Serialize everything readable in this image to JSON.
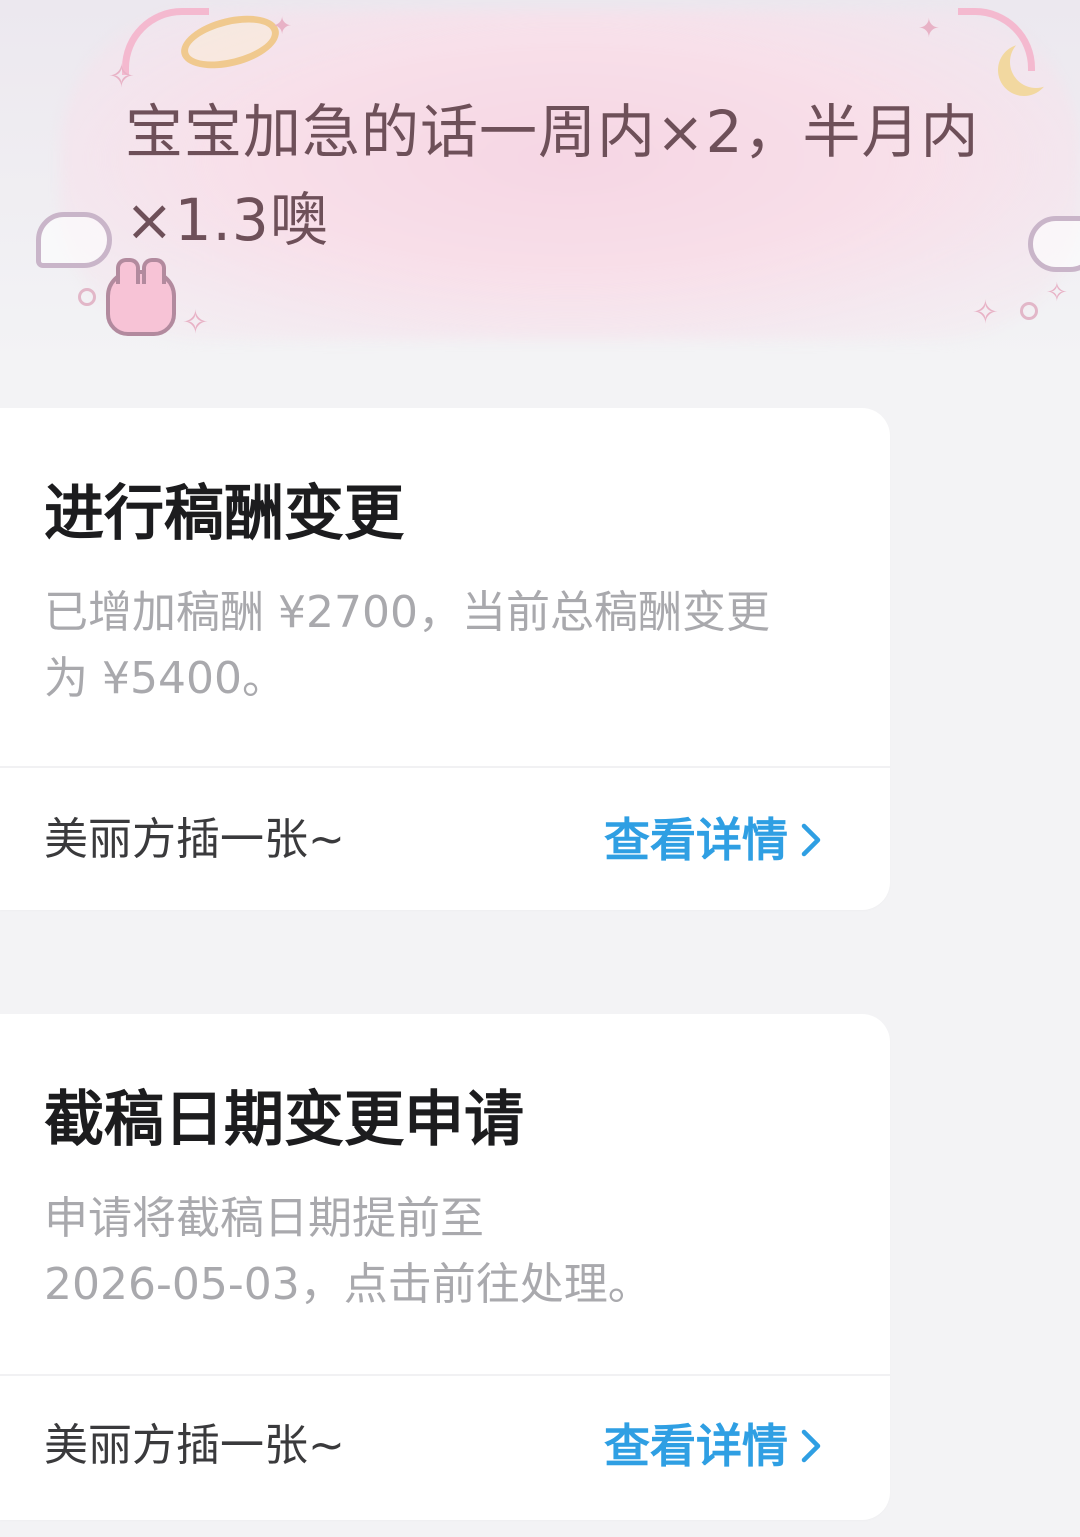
{
  "header_bubble": {
    "line1": "宝宝加急的话一周内×2，半月内",
    "line2": "×1.3噢"
  },
  "cards": [
    {
      "title": "进行稿酬变更",
      "description_line1": "已增加稿酬 ¥2700，当前总稿酬变更",
      "description_line2": "为 ¥5400。",
      "footer_label": "美丽方插一张~",
      "link_label": "查看详情"
    },
    {
      "title": "截稿日期变更申请",
      "description_line1": "申请将截稿日期提前至",
      "description_line2": "2026-05-03，点击前往处理。",
      "footer_label": "美丽方插一张~",
      "link_label": "查看详情"
    }
  ],
  "colors": {
    "link": "#2f9fe3",
    "title": "#1c1c1e",
    "description": "#a9a9ad",
    "bubble_text": "#6e5059"
  },
  "icons": {
    "link_chevron": "chevron-right-icon",
    "decorations": [
      "halo-icon",
      "angel-wing-icon",
      "moon-icon",
      "bunny-icon",
      "sparkle-icon"
    ]
  }
}
